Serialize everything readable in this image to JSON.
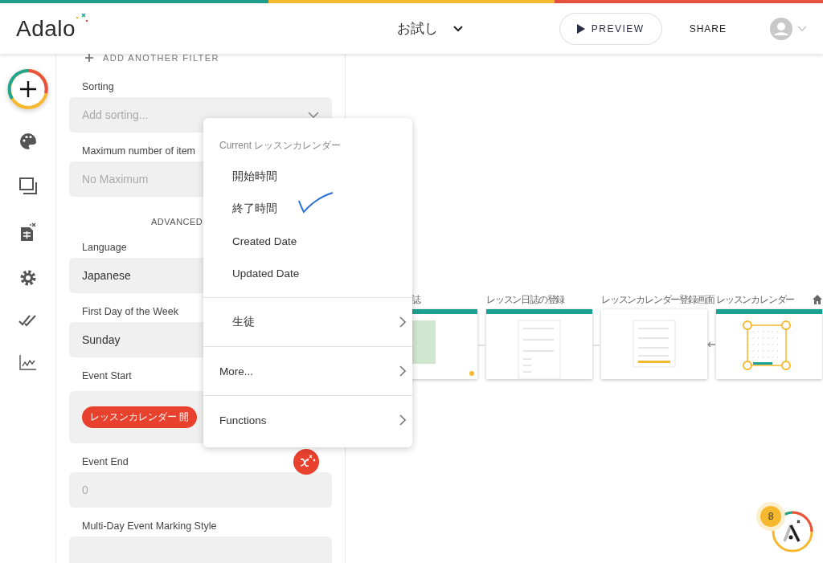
{
  "header": {
    "logo": "Adalo",
    "app_name": "お試し",
    "preview": "PREVIEW",
    "share": "SHARE"
  },
  "panel": {
    "add_filter": "ADD ANOTHER FILTER",
    "fields": [
      {
        "kind": "dropdown",
        "label": "Sorting",
        "placeholder": "Add sorting..."
      },
      {
        "kind": "field",
        "label": "Maximum number of item",
        "placeholder": "No Maximum"
      },
      {
        "kind": "section",
        "label": "ADVANCED"
      },
      {
        "kind": "field",
        "label": "Language",
        "value": "Japanese"
      },
      {
        "kind": "field",
        "label": "First Day of the Week",
        "value": "Sunday"
      },
      {
        "kind": "chip",
        "label": "Event Start",
        "chip": "レッスンカレンダー 開"
      },
      {
        "kind": "field",
        "label": "Event End",
        "placeholder": "0",
        "magic_text": true
      },
      {
        "kind": "field",
        "label": "Multi-Day Event Marking Style"
      }
    ]
  },
  "menu": {
    "header": "Current レッスンカレンダー",
    "sections": [
      {
        "items": [
          {
            "kind": "property",
            "label": "開始時間",
            "submenu": false,
            "marked": false
          },
          {
            "kind": "property",
            "label": "終了時間",
            "submenu": false,
            "marked": true
          },
          {
            "kind": "property",
            "label": "Created Date",
            "submenu": false,
            "marked": false
          },
          {
            "kind": "property",
            "label": "Updated Date",
            "submenu": false,
            "marked": false
          }
        ]
      },
      {
        "items": [
          {
            "kind": "relation",
            "label": "生徒",
            "submenu": true,
            "marked": false
          }
        ]
      },
      {
        "items": [
          {
            "kind": "group",
            "label": "More...",
            "submenu": true,
            "marked": false
          }
        ]
      },
      {
        "items": [
          {
            "kind": "group",
            "label": "Functions",
            "submenu": true,
            "marked": false
          }
        ]
      }
    ]
  },
  "canvas": {
    "screens": [
      {
        "title": "誌",
        "kind": "list",
        "home": false,
        "selected": false
      },
      {
        "title": "レッスン日誌の登録",
        "kind": "form",
        "home": false,
        "selected": false
      },
      {
        "title": "レッスンカレンダー登録画面",
        "kind": "modal",
        "home": false,
        "selected": false
      },
      {
        "title": "レッスンカレンダー",
        "kind": "calendar",
        "home": true,
        "selected": true
      }
    ]
  },
  "help": {
    "badge": "8"
  }
}
